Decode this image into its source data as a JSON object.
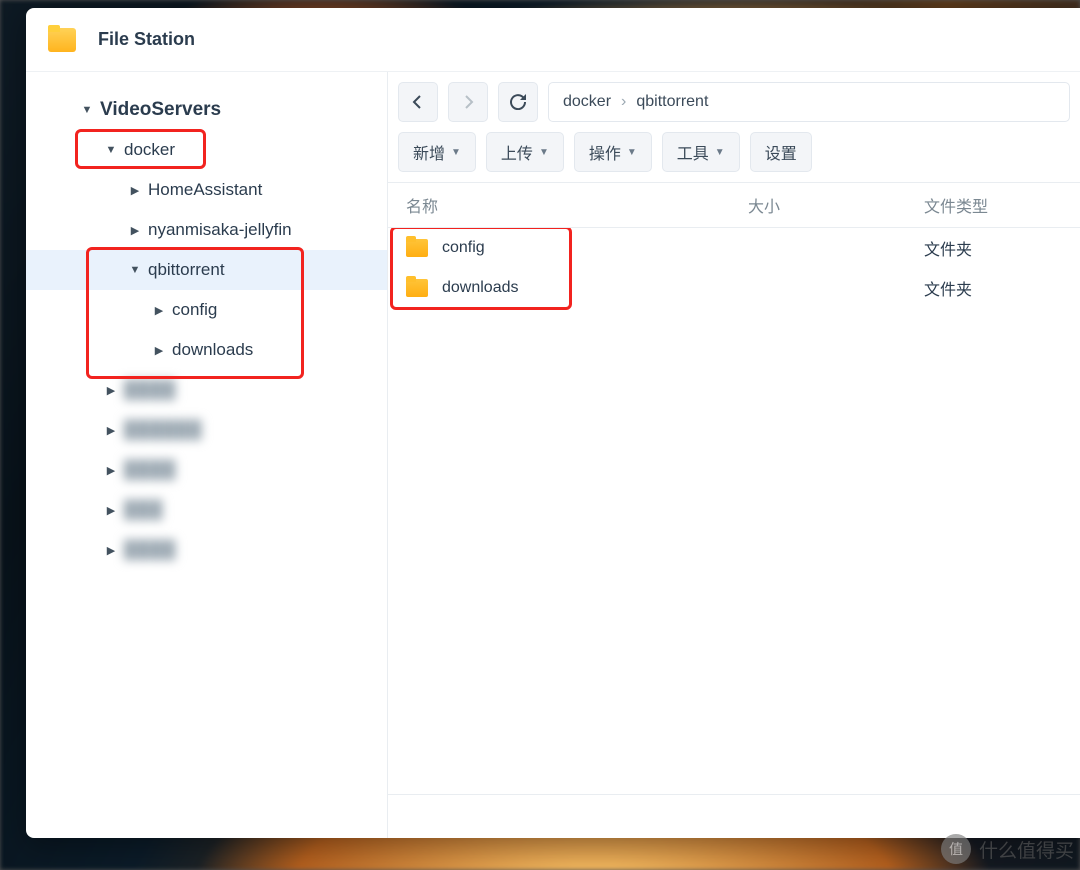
{
  "app": {
    "title": "File Station"
  },
  "tree": {
    "root": "VideoServers",
    "docker": "docker",
    "docker_children": [
      "HomeAssistant",
      "nyanmisaka-jellyfin"
    ],
    "qbittorrent": "qbittorrent",
    "qb_children": [
      "config",
      "downloads"
    ]
  },
  "breadcrumb": {
    "seg1": "docker",
    "seg2": "qbittorrent"
  },
  "toolbar": {
    "new_label": "新增",
    "upload_label": "上传",
    "action_label": "操作",
    "tools_label": "工具",
    "settings_label": "设置"
  },
  "columns": {
    "name": "名称",
    "size": "大小",
    "type": "文件类型"
  },
  "rows": [
    {
      "name": "config",
      "size": "",
      "type": "文件夹"
    },
    {
      "name": "downloads",
      "size": "",
      "type": "文件夹"
    }
  ],
  "watermark": {
    "badge": "值",
    "text": "什么值得买"
  }
}
